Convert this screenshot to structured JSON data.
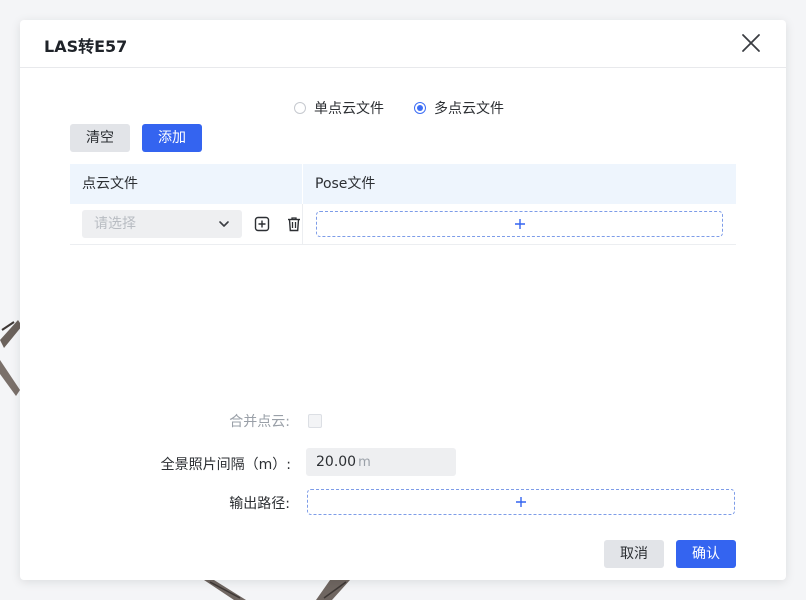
{
  "dialog": {
    "title": "LAS转E57",
    "close_icon": "close-icon"
  },
  "mode": {
    "options": [
      {
        "label": "单点云文件",
        "checked": false
      },
      {
        "label": "多点云文件",
        "checked": true
      }
    ]
  },
  "toolbar": {
    "clear_label": "清空",
    "add_label": "添加"
  },
  "table": {
    "headers": [
      "点云文件",
      "Pose文件"
    ],
    "rows": [
      {
        "select_placeholder": "请选择"
      }
    ]
  },
  "form": {
    "merge_label": "合并点云:",
    "merge_checked": false,
    "interval_label": "全景照片间隔（m）:",
    "interval_value": "20.00",
    "interval_unit": "m",
    "output_label": "输出路径:"
  },
  "footer": {
    "cancel_label": "取消",
    "confirm_label": "确认"
  },
  "colors": {
    "primary": "#3464f0",
    "header_bg": "#eef5fd",
    "dashed_border": "#7d9ce8"
  }
}
